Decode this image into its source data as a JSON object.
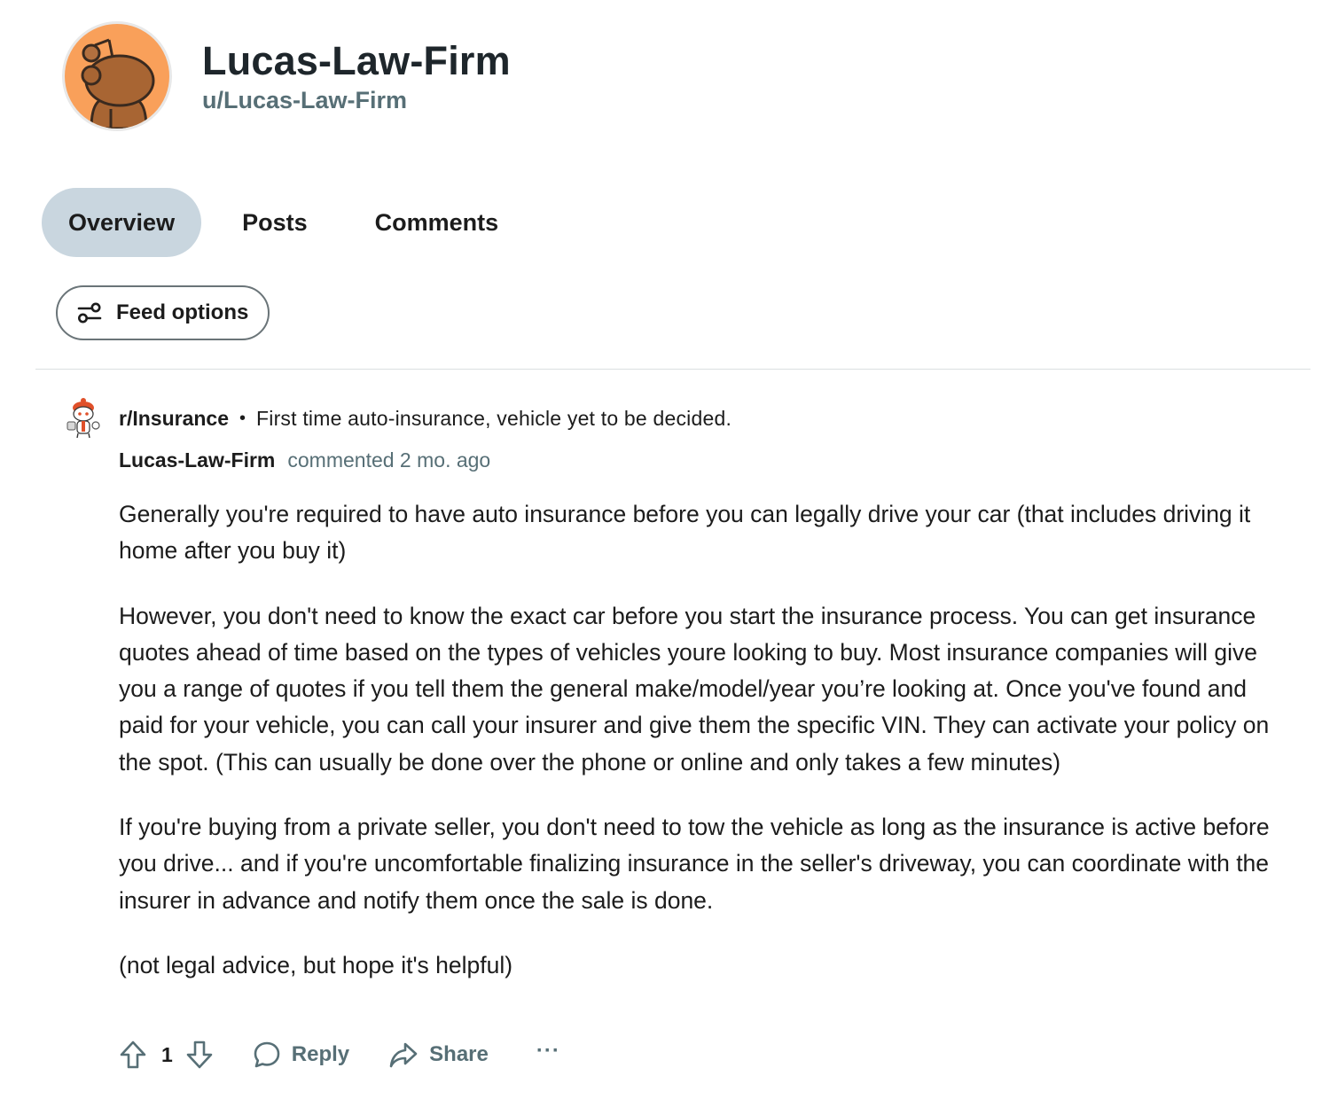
{
  "profile": {
    "display_name": "Lucas-Law-Firm",
    "username": "u/Lucas-Law-Firm",
    "avatar_color": "#f9a05a"
  },
  "tabs": [
    {
      "label": "Overview",
      "active": true
    },
    {
      "label": "Posts",
      "active": false
    },
    {
      "label": "Comments",
      "active": false
    }
  ],
  "feed_options": {
    "label": "Feed options",
    "icon": "sliders-icon"
  },
  "comment": {
    "subreddit": "r/Insurance",
    "separator": "•",
    "post_title": "First time auto-insurance, vehicle yet to be decided.",
    "author": "Lucas-Law-Firm",
    "time": "commented 2 mo. ago",
    "paragraphs": [
      "Generally you're required to have auto insurance before you can legally drive your car (that includes driving it home after you buy it)",
      "However, you don't need to know the exact car before you start the insurance process. You can get insurance quotes ahead of time based on the types of vehicles youre looking to buy. Most insurance companies will give you a range of quotes if you tell them the general make/model/year you’re looking at. Once you've found and paid for your vehicle, you can call your insurer and give them the specific VIN. They can activate your policy on the spot. (This can usually be done over the phone or online and only takes a few minutes)",
      "If you're buying from a private seller, you don't need to tow the vehicle as long as the insurance is active before you drive... and if you're uncomfortable finalizing insurance in the seller's driveway, you can coordinate with the insurer in advance and notify them once the sale is done.",
      "(not legal advice, but hope it's helpful)"
    ],
    "score": "1",
    "reply_label": "Reply",
    "share_label": "Share",
    "more_label": "···"
  },
  "colors": {
    "active_tab_bg": "#c9d6df",
    "muted_text": "#576f76",
    "divider": "#dadfe1"
  }
}
